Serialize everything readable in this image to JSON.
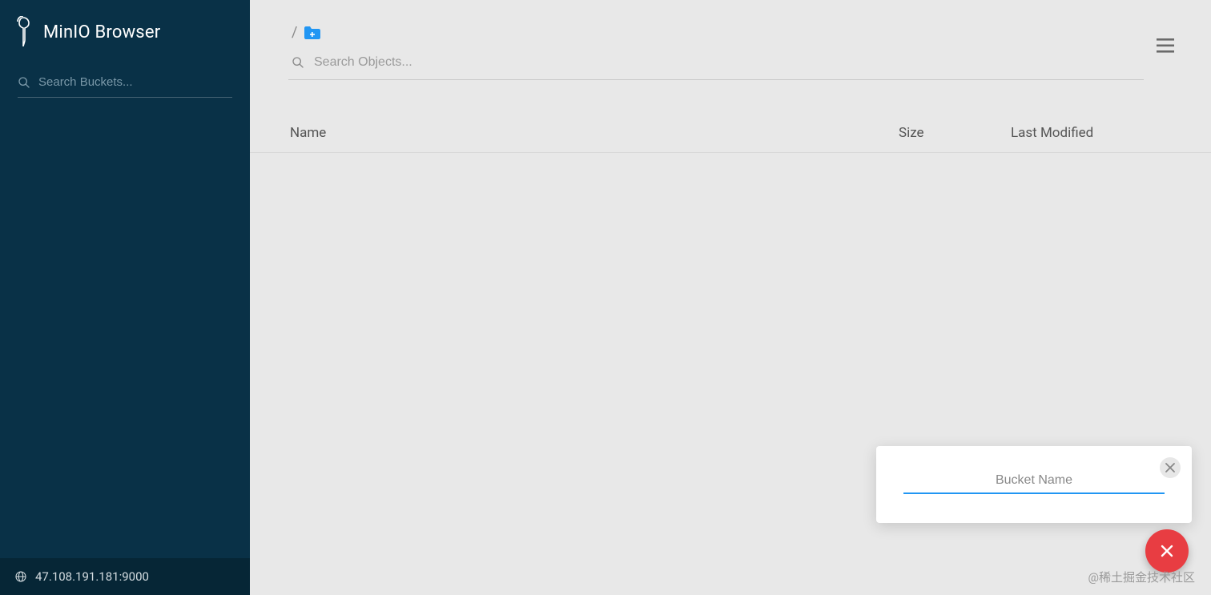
{
  "brand": {
    "title": "MinIO Browser"
  },
  "sidebar": {
    "search_placeholder": "Search Buckets...",
    "host": "47.108.191.181:9000"
  },
  "main": {
    "breadcrumb_slash": "/",
    "search_placeholder": "Search Objects...",
    "columns": {
      "name": "Name",
      "size": "Size",
      "modified": "Last Modified"
    }
  },
  "popover": {
    "placeholder": "Bucket Name"
  },
  "watermark": "@稀土掘金技术社区",
  "icons": {
    "logo": "minio-bird-logo",
    "search": "search-icon",
    "globe": "globe-icon",
    "folder_add": "folder-add-icon",
    "hamburger": "menu-icon",
    "close": "close-icon",
    "fab": "close-fab-icon"
  },
  "colors": {
    "sidebar_bg": "#093147",
    "sidebar_footer_bg": "#062636",
    "accent_blue": "#2196f3",
    "fab_red": "#e83d42",
    "folder_blue": "#2196f3"
  }
}
